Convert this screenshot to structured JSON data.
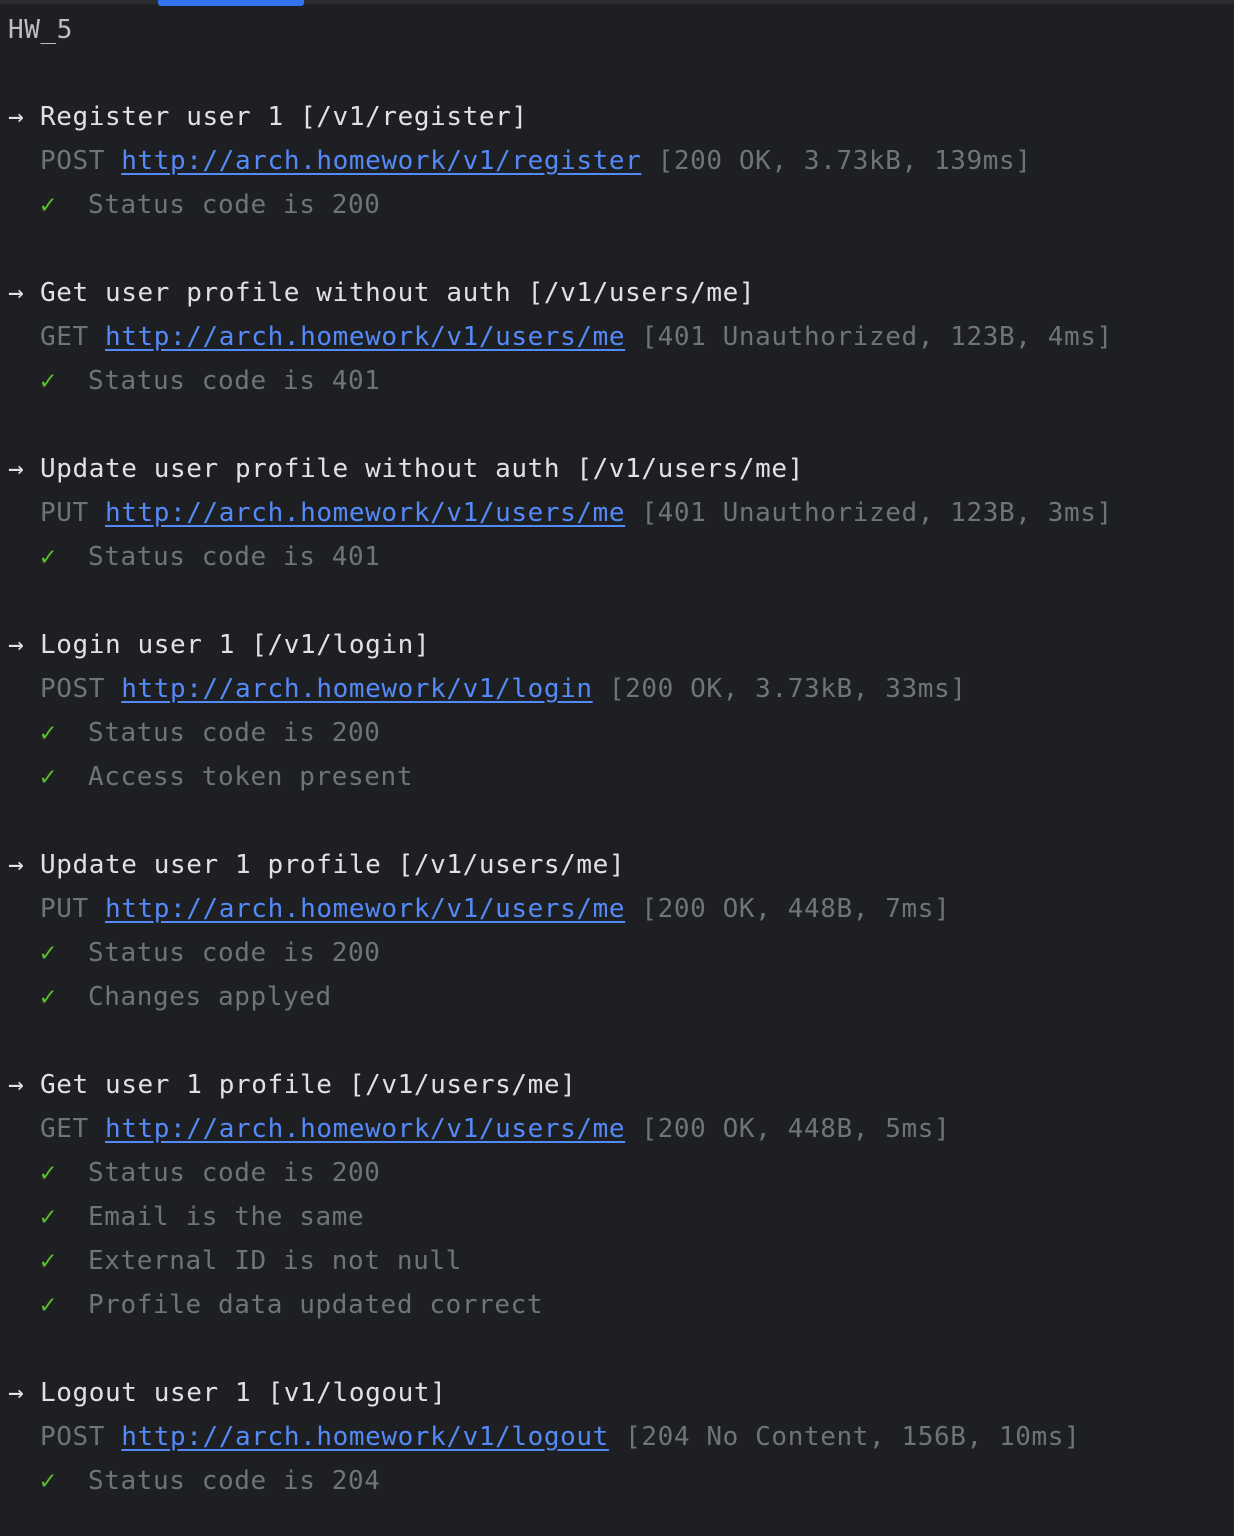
{
  "collection": {
    "title": "HW_5"
  },
  "requests": [
    {
      "title": "Register user 1 [/v1/register]",
      "method": "POST",
      "url": "http://arch.homework/v1/register",
      "meta": "[200 OK, 3.73kB, 139ms]",
      "checks": [
        "Status code is 200"
      ]
    },
    {
      "title": "Get user profile without auth [/v1/users/me]",
      "method": "GET",
      "url": "http://arch.homework/v1/users/me",
      "meta": "[401 Unauthorized, 123B, 4ms]",
      "checks": [
        "Status code is 401"
      ]
    },
    {
      "title": "Update user profile without auth [/v1/users/me]",
      "method": "PUT",
      "url": "http://arch.homework/v1/users/me",
      "meta": "[401 Unauthorized, 123B, 3ms]",
      "checks": [
        "Status code is 401"
      ]
    },
    {
      "title": "Login user 1 [/v1/login]",
      "method": "POST",
      "url": "http://arch.homework/v1/login",
      "meta": "[200 OK, 3.73kB, 33ms]",
      "checks": [
        "Status code is 200",
        "Access token present"
      ]
    },
    {
      "title": "Update user 1 profile [/v1/users/me]",
      "method": "PUT",
      "url": "http://arch.homework/v1/users/me",
      "meta": "[200 OK, 448B, 7ms]",
      "checks": [
        "Status code is 200",
        "Changes applyed"
      ]
    },
    {
      "title": "Get user 1 profile [/v1/users/me]",
      "method": "GET",
      "url": "http://arch.homework/v1/users/me",
      "meta": "[200 OK, 448B, 5ms]",
      "checks": [
        "Status code is 200",
        "Email is the same",
        "External ID is not null",
        "Profile data updated correct"
      ]
    },
    {
      "title": "Logout user 1 [v1/logout]",
      "method": "POST",
      "url": "http://arch.homework/v1/logout",
      "meta": "[204 No Content, 156B, 10ms]",
      "checks": [
        "Status code is 204"
      ]
    }
  ],
  "icons": {
    "arrow": "→",
    "check": "✓"
  },
  "colors": {
    "background": "#1e1f22",
    "title": "#dfe1e5",
    "muted": "#6f737a",
    "link": "#548af7",
    "check": "#5fb832",
    "tab_accent": "#3574f0"
  }
}
